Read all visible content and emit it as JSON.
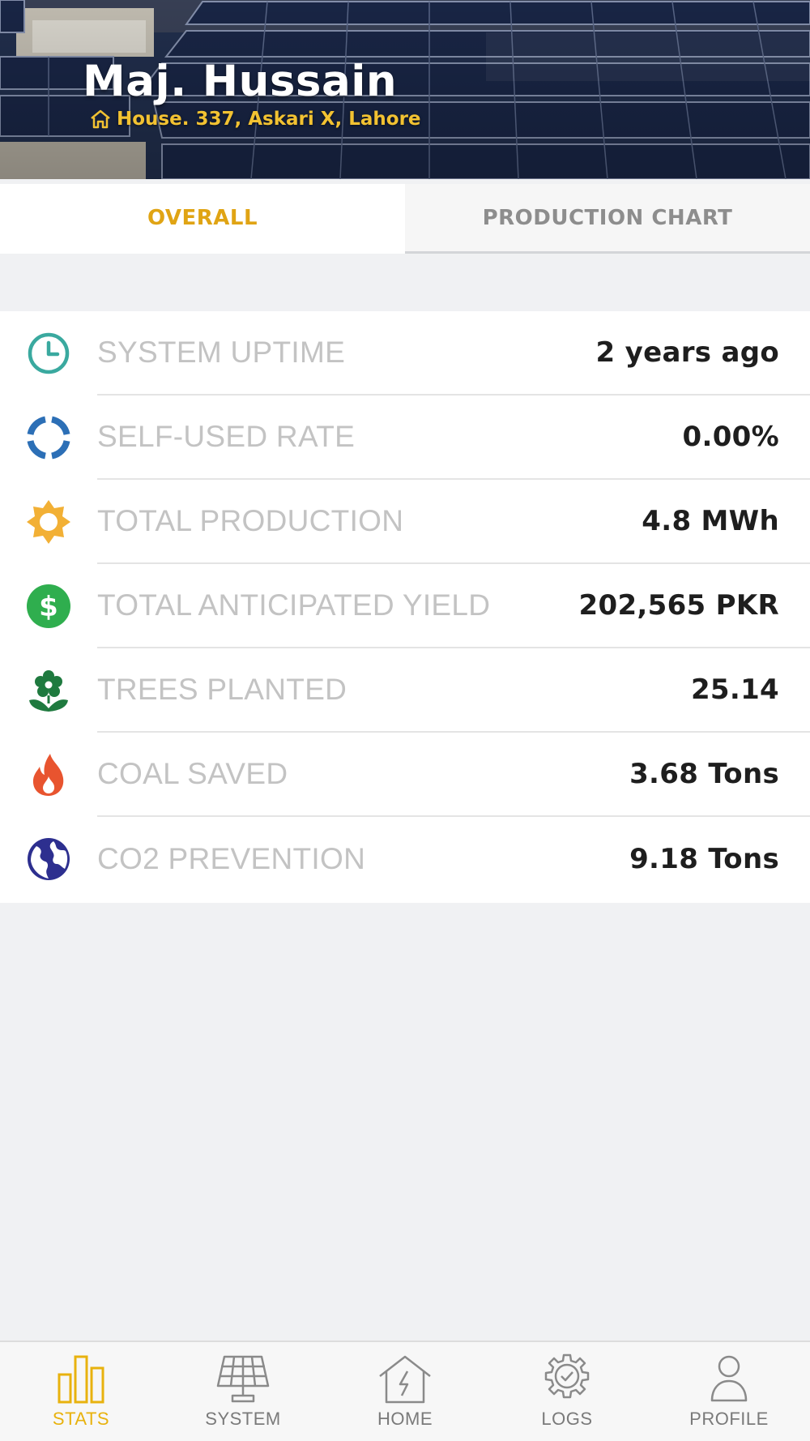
{
  "header": {
    "owner_name": "Maj. Hussain",
    "address": "House. 337, Askari X, Lahore",
    "icon": "home-outline-icon"
  },
  "tabs": [
    {
      "label": "OVERALL",
      "active": true
    },
    {
      "label": "PRODUCTION CHART",
      "active": false
    }
  ],
  "stats": [
    {
      "icon": "clock-icon",
      "label": "SYSTEM UPTIME",
      "value": "2 years ago",
      "color": "#3aa99f"
    },
    {
      "icon": "donut-progress-icon",
      "label": "SELF-USED RATE",
      "value": "0.00%",
      "color": "#2c6fb6"
    },
    {
      "icon": "sun-icon",
      "label": "TOTAL PRODUCTION",
      "value": "4.8 MWh",
      "color": "#f2b035"
    },
    {
      "icon": "dollar-icon",
      "label": "TOTAL ANTICIPATED YIELD",
      "value": "202,565 PKR",
      "color": "#2fae4e"
    },
    {
      "icon": "flower-icon",
      "label": "TREES PLANTED",
      "value": "25.14",
      "color": "#1f7a3f"
    },
    {
      "icon": "flame-icon",
      "label": "COAL SAVED",
      "value": "3.68 Tons",
      "color": "#e8542f"
    },
    {
      "icon": "globe-icon",
      "label": "CO2 PREVENTION",
      "value": "9.18 Tons",
      "color": "#2d2f8f"
    }
  ],
  "bottom_nav": [
    {
      "icon": "bar-chart-icon",
      "label": "STATS",
      "active": true
    },
    {
      "icon": "solar-panel-icon",
      "label": "SYSTEM",
      "active": false
    },
    {
      "icon": "home-bolt-icon",
      "label": "HOME",
      "active": false
    },
    {
      "icon": "gear-check-icon",
      "label": "LOGS",
      "active": false
    },
    {
      "icon": "user-icon",
      "label": "PROFILE",
      "active": false
    }
  ],
  "colors": {
    "accent": "#e0a414",
    "nav_active": "#e8b20e",
    "label_gray": "#c3c3c3",
    "value_dark": "#1e1e1e",
    "background": "#f0f1f3"
  }
}
